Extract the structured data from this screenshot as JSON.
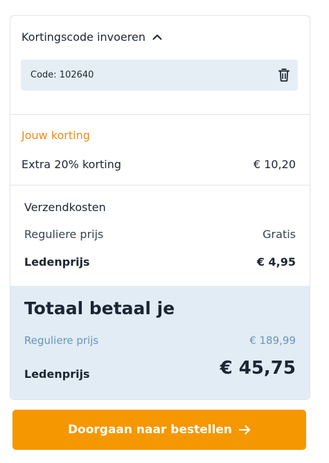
{
  "discount_code": {
    "toggle_label": "Kortingscode invoeren",
    "applied_code": "Code: 102640"
  },
  "discount": {
    "heading": "Jouw korting",
    "description": "Extra 20% korting",
    "amount": "€ 10,20"
  },
  "shipping": {
    "heading": "Verzendkosten",
    "regular_label": "Reguliere prijs",
    "regular_value": "Gratis",
    "member_label": "Ledenprijs",
    "member_value": "€ 4,95"
  },
  "total": {
    "title": "Totaal betaal je",
    "regular_label": "Reguliere prijs",
    "regular_value": "€ 189,99",
    "member_label": "Ledenprijs",
    "member_value": "€ 45,75"
  },
  "checkout": {
    "button_label": "Doorgaan naar bestellen"
  },
  "icons": [
    "chevron-up-icon",
    "trash-icon",
    "arrow-right-icon"
  ],
  "colors": {
    "accent_orange": "#f59700",
    "discount_heading": "#ef8a1a",
    "total_background": "#e1ecf5",
    "code_chip_background": "#e6eef5",
    "regular_price_blue": "#6a94bb",
    "text_dark": "#1c2533"
  }
}
